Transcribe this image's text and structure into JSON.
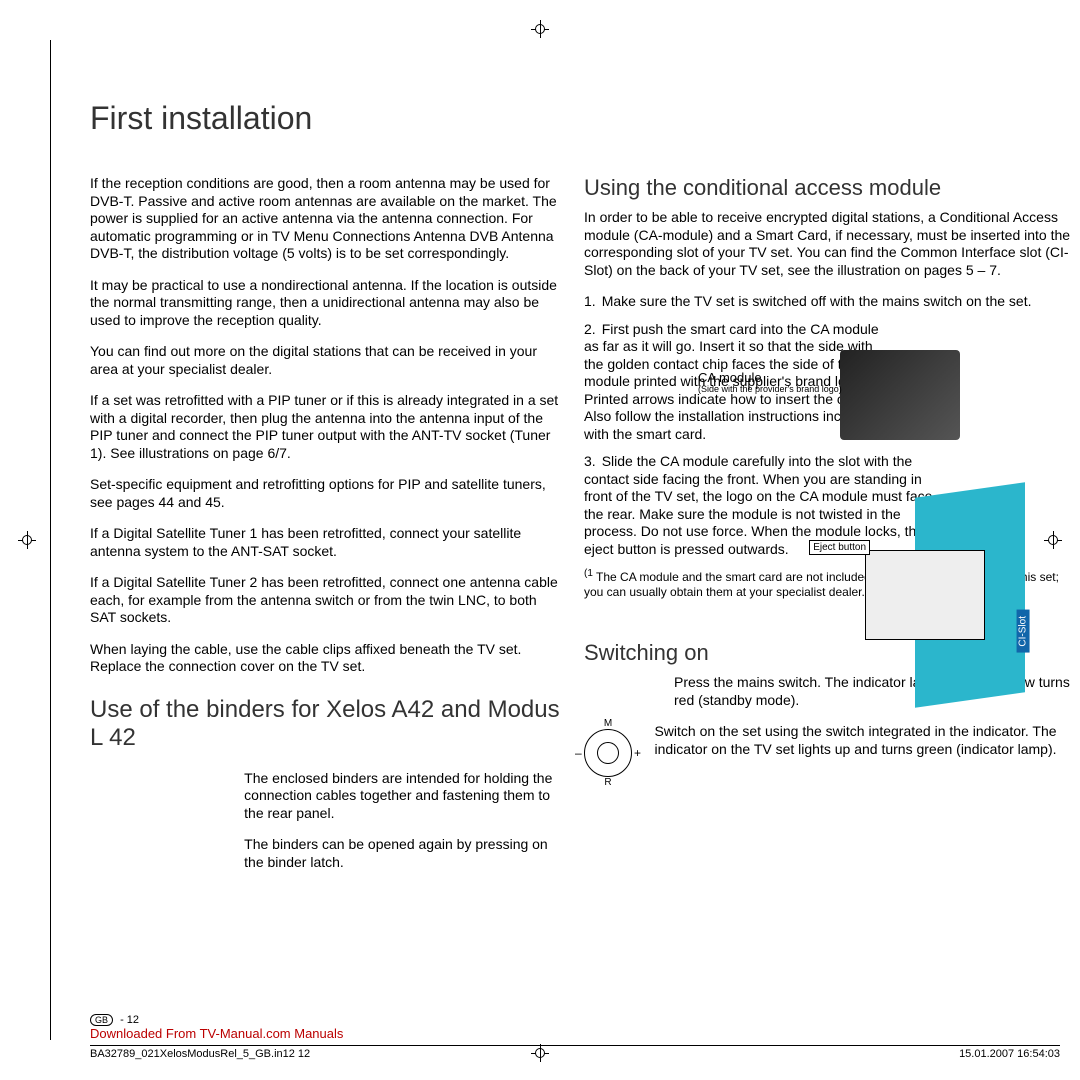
{
  "title": "First installation",
  "left": {
    "p1": "If the reception conditions are good, then a room antenna may be used for DVB-T. Passive and active room antennas are available on the market. The power is supplied for an active antenna via the antenna connection. For automatic programming or in  TV Menu  Connections  Antenna DVB  Antenna DVB-T, the distribution voltage (5 volts) is to be set correspondingly.",
    "p2": "It may be practical to use a nondirectional antenna. If the location is outside the normal transmitting range, then a unidirectional antenna may also be used to improve the reception quality.",
    "p3": "You can find out more on the digital stations that can be received in your area at your specialist dealer.",
    "p4": "If a set was retrofitted with a PIP tuner or if this is already integrated in a set with a digital recorder, then plug the antenna into the antenna input of the PIP tuner and connect the PIP tuner output with the ANT-TV socket (Tuner 1). See illustrations on page 6/7.",
    "p5": "Set-specific equipment and retrofitting options for PIP and satellite tuners, see pages 44 and 45.",
    "p6": "If a Digital Satellite Tuner 1 has been retrofitted, connect your satellite antenna system to the ANT-SAT socket.",
    "p7": "If a Digital Satellite Tuner 2 has been retrofitted, connect one antenna cable each, for example from the antenna switch or from the twin LNC, to both SAT sockets.",
    "p8": "When laying the cable, use the cable clips affixed beneath the TV set. Replace the connection cover on the TV set.",
    "binders_h": "Use of the binders for Xelos A42 and Modus L 42",
    "binders_p1": "The enclosed binders are intended for holding the connection cables together and fastening them to the rear panel.",
    "binders_p2": "The binders can be opened again by pressing on the binder latch."
  },
  "right": {
    "h": "Using the conditional access module",
    "intro": "In order to be able to receive encrypted digital stations, a Conditional Access module (CA-module) and a Smart Card, if necessary, must be inserted into the corresponding slot of your TV set. You can find the Common Interface slot (CI-Slot) on the back of your TV set, see the illustration on pages 5 – 7.",
    "steps": [
      "Make sure the TV set is switched off with the mains switch on the set.",
      "First push the smart card into the CA module as far as it will go. Insert it so that the side with the golden contact chip faces the side of the module printed with the supplier's brand logo. Printed arrows indicate how to insert the card. Also follow the installation instructions included with the smart card.",
      "Slide the CA module carefully into the slot with the contact side facing the front. When you are standing in front of the TV set, the logo on the CA module must face the rear. Make sure the module is not twisted in the process. Do not use force. When the module locks, the eject button is pressed outwards."
    ],
    "footnote": "The CA module and the smart card are not included in the scope of delivery for this set; you can usually obtain them at your specialist dealer.",
    "ca_label": "CA module",
    "ca_sub": "(Side with the provider's brand logo)",
    "eject": "Eject button",
    "ci": "CI-Slot",
    "switch_h": "Switching on",
    "switch_p1": "Press the mains switch. The indicator lamp on the set now turns red (standby mode).",
    "switch_p2": "Switch on the set using the switch integrated in the indicator. The indicator on the TV set lights up and turns green (indicator lamp).",
    "dial": {
      "m": "M",
      "r": "R",
      "minus": "–",
      "plus": "+"
    }
  },
  "footer": {
    "link": "Downloaded From TV-Manual.com Manuals",
    "file": "BA32789_021XelosModusRel_5_GB.in12   12",
    "date": "15.01.2007   16:54:03",
    "gb": "GB",
    "page": " - 12"
  }
}
